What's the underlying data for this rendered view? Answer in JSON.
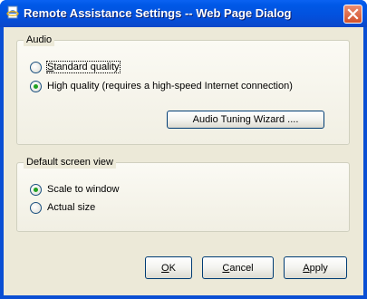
{
  "window": {
    "title": "Remote Assistance Settings -- Web Page Dialog",
    "icon": "ie-document-icon",
    "close_icon": "close-icon"
  },
  "audio": {
    "legend": "Audio",
    "options": [
      {
        "label_first": "S",
        "label_rest": "tandard quality",
        "checked": false
      },
      {
        "label_first": "",
        "label_rest": "High quality (requires a high-speed Internet connection)",
        "checked": true
      }
    ],
    "tuning_button": "Audio Tuning Wizard ...."
  },
  "screen_view": {
    "legend": "Default screen view",
    "options": [
      {
        "label": "Scale to window",
        "checked": true
      },
      {
        "label": "Actual size",
        "checked": false
      }
    ]
  },
  "buttons": {
    "ok_first": "O",
    "ok_rest": "K",
    "cancel_first": "C",
    "cancel_rest": "ancel",
    "apply_first": "A",
    "apply_rest": "pply"
  },
  "colors": {
    "titlebar": "#0058e6",
    "dialog_bg": "#ece9d8",
    "radio_dot": "#21a121"
  }
}
